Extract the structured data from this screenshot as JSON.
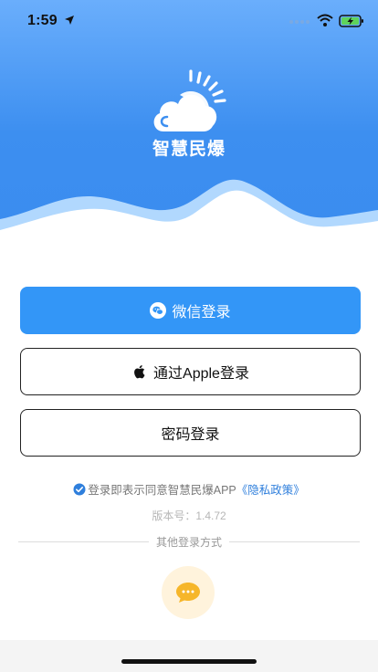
{
  "status_bar": {
    "time": "1:59",
    "icons": [
      "location-arrow-icon",
      "wifi-icon",
      "battery-charging-icon"
    ]
  },
  "header": {
    "app_name": "智慧民爆",
    "logo_icon": "cloud-sun-icon",
    "gradient_colors": [
      "#6aaefc",
      "#3a8cef"
    ]
  },
  "login_options": {
    "wechat_label": "微信登录",
    "apple_label": "通过Apple登录",
    "password_label": "密码登录"
  },
  "agreement": {
    "text": "登录即表示同意智慧民爆APP",
    "policy_link": "《隐私政策》",
    "checked": true
  },
  "version": "版本号：1.4.72",
  "other_login": {
    "label": "其他登录方式",
    "icon": "chat-bubble-icon"
  },
  "colors": {
    "primary": "#3396f7",
    "link": "#2f7fdc",
    "other_login_bg": "#fff3dc",
    "other_login_icon": "#f6b62a"
  }
}
